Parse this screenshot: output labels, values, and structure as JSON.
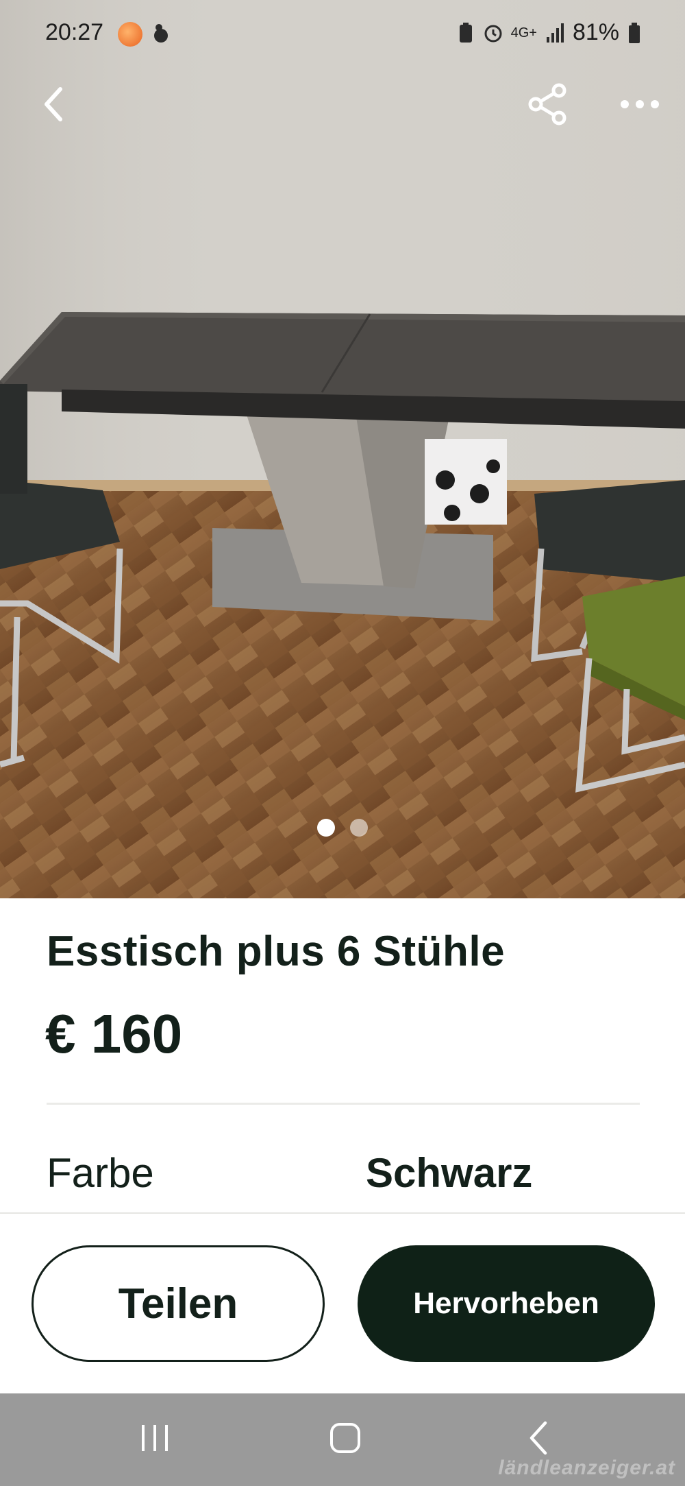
{
  "status_bar": {
    "time": "20:27",
    "network": "4G+",
    "battery": "81%",
    "icons": [
      "app-notification-icon",
      "alarm-icon",
      "signal-icon",
      "battery-icon"
    ]
  },
  "navigation": {
    "back_icon": "chevron-left-icon",
    "share_icon": "share-icon",
    "more_icon": "more-horizontal-icon"
  },
  "gallery": {
    "image_count": 2,
    "active_index": 0
  },
  "listing": {
    "title": "Esstisch plus 6 Stühle",
    "price": "€ 160",
    "attributes": [
      {
        "label": "Farbe",
        "value": "Schwarz"
      }
    ]
  },
  "actions": {
    "share_label": "Teilen",
    "highlight_label": "Hervorheben"
  },
  "system_nav": {
    "icons": [
      "recents-icon",
      "home-icon",
      "back-icon"
    ]
  },
  "watermark": "ländleanzeiger.at",
  "colors": {
    "primary_dark": "#0f2117",
    "text": "#13201a",
    "system_bar": "#9a9a9a"
  }
}
